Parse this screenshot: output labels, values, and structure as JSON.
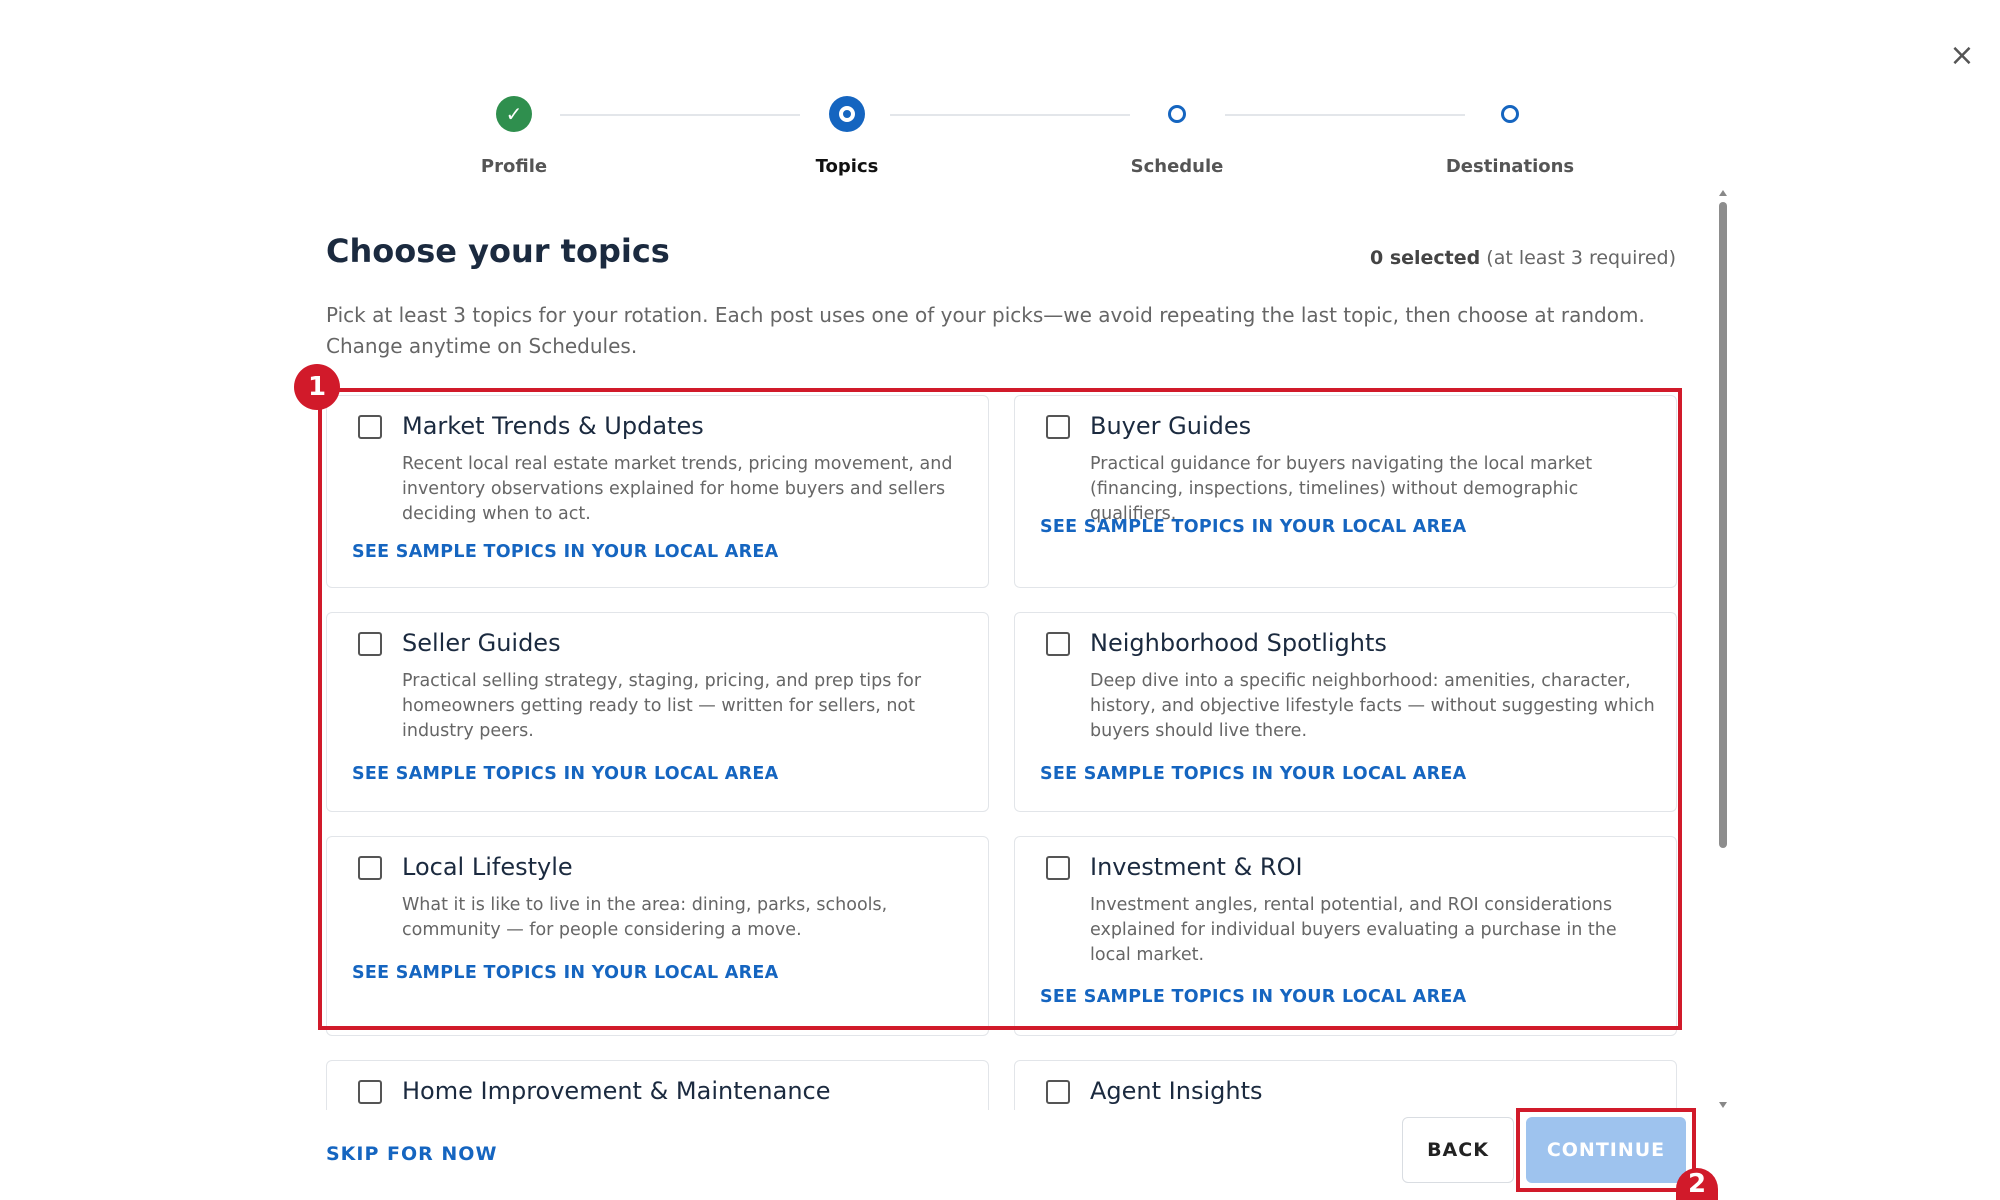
{
  "dialog": {
    "close_glyph": "×"
  },
  "stepper": {
    "steps": [
      {
        "label": "Profile",
        "state": "done",
        "glyph": "✓"
      },
      {
        "label": "Topics",
        "state": "active"
      },
      {
        "label": "Schedule",
        "state": "pending"
      },
      {
        "label": "Destinations",
        "state": "pending"
      }
    ]
  },
  "header": {
    "title": "Choose your topics",
    "selected_count": "0 selected",
    "requirement": "(at least 3 required)",
    "description": "Pick at least 3 topics for your rotation. Each post uses one of your picks—we avoid repeating the last topic, then choose at random. Change anytime on Schedules."
  },
  "topics": [
    {
      "title": "Market Trends & Updates",
      "description": "Recent local real estate market trends, pricing movement, and inventory observations explained for home buyers and sellers deciding when to act.",
      "link": "SEE SAMPLE TOPICS IN YOUR LOCAL AREA"
    },
    {
      "title": "Buyer Guides",
      "description": "Practical guidance for buyers navigating the local market (financing, inspections, timelines) without demographic qualifiers.",
      "link": "SEE SAMPLE TOPICS IN YOUR LOCAL AREA"
    },
    {
      "title": "Seller Guides",
      "description": "Practical selling strategy, staging, pricing, and prep tips for homeowners getting ready to list — written for sellers, not industry peers.",
      "link": "SEE SAMPLE TOPICS IN YOUR LOCAL AREA"
    },
    {
      "title": "Neighborhood Spotlights",
      "description": "Deep dive into a specific neighborhood: amenities, character, history, and objective lifestyle facts — without suggesting which buyers should live there.",
      "link": "SEE SAMPLE TOPICS IN YOUR LOCAL AREA"
    },
    {
      "title": "Local Lifestyle",
      "description": "What it is like to live in the area: dining, parks, schools, community — for people considering a move.",
      "link": "SEE SAMPLE TOPICS IN YOUR LOCAL AREA"
    },
    {
      "title": "Investment & ROI",
      "description": "Investment angles, rental potential, and ROI considerations explained for individual buyers evaluating a purchase in the local market.",
      "link": "SEE SAMPLE TOPICS IN YOUR LOCAL AREA"
    },
    {
      "title": "Home Improvement & Maintenance"
    },
    {
      "title": "Agent Insights"
    }
  ],
  "footer": {
    "skip_label": "SKIP FOR NOW",
    "back_label": "BACK",
    "continue_label": "CONTINUE"
  },
  "annotations": [
    {
      "label": "1",
      "color": "#d11a2a"
    },
    {
      "label": "2",
      "color": "#d11a2a"
    }
  ]
}
